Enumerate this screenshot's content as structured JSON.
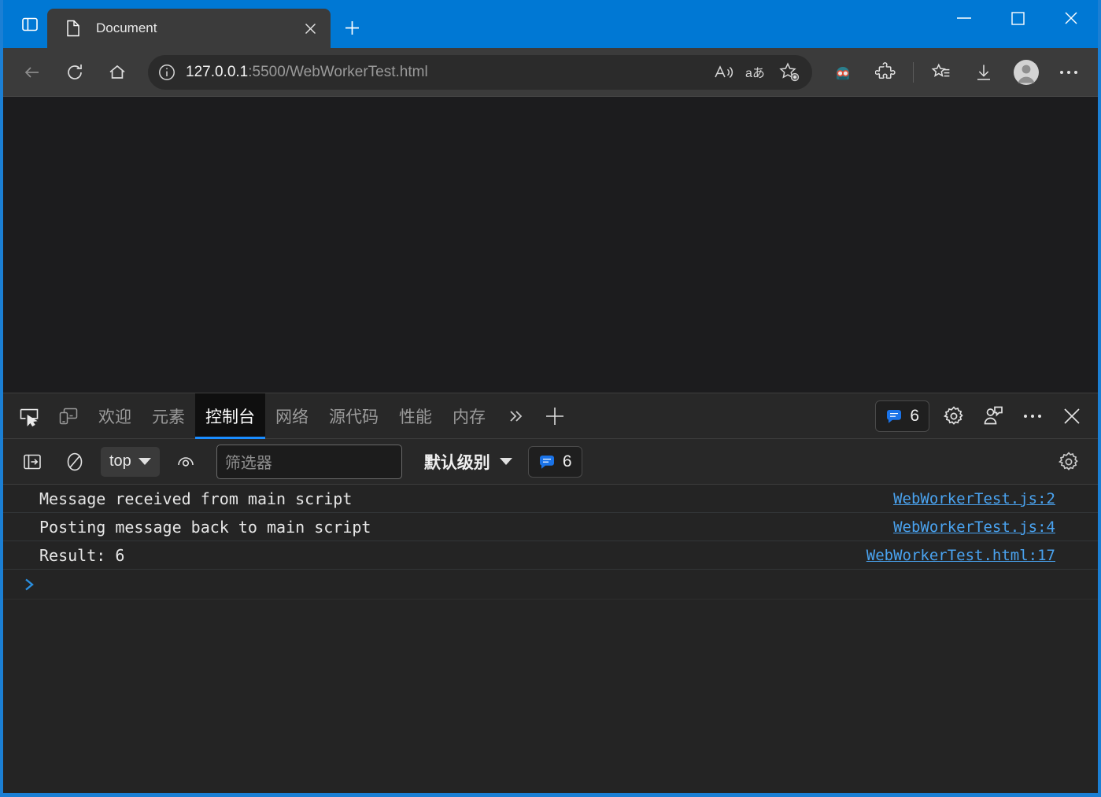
{
  "window": {
    "accent_color": "#0078d4",
    "controls": {
      "minimize": "minimize",
      "maximize": "maximize",
      "close": "close"
    }
  },
  "browser": {
    "tab_actions_label": "tab-actions",
    "tabs": [
      {
        "title": "Document",
        "favicon": "page-icon",
        "close_label": "close-tab"
      }
    ],
    "new_tab_label": "new-tab",
    "toolbar": {
      "back_label": "back",
      "refresh_label": "refresh",
      "home_label": "home",
      "read_aloud_label": "read-aloud",
      "translate_label": "translate",
      "add_favorite_label": "add-favorite",
      "extension_label": "browser-extension",
      "extensions_label": "extensions",
      "collections_label": "collections",
      "downloads_label": "downloads",
      "profile_label": "profile",
      "settings_more_label": "settings-and-more"
    },
    "omnibox": {
      "host": "127.0.0.1",
      "path": ":5500/WebWorkerTest.html",
      "info_icon": "site-information-icon"
    }
  },
  "devtools": {
    "inspect_label": "inspect-element",
    "device_toolbar_label": "device-emulation",
    "tabs": [
      {
        "label": "欢迎",
        "active": false,
        "name": "welcome"
      },
      {
        "label": "元素",
        "active": false,
        "name": "elements"
      },
      {
        "label": "控制台",
        "active": true,
        "name": "console"
      },
      {
        "label": "网络",
        "active": false,
        "name": "network"
      },
      {
        "label": "源代码",
        "active": false,
        "name": "sources"
      },
      {
        "label": "性能",
        "active": false,
        "name": "performance"
      },
      {
        "label": "内存",
        "active": false,
        "name": "memory"
      }
    ],
    "more_tabs_label": "»",
    "add_panel_label": "+",
    "issues_badge_count": "6",
    "settings_label": "settings",
    "feedback_label": "send-feedback",
    "more_options_label": "more-options",
    "close_label": "close-devtools",
    "console_toolbar": {
      "sidebar_toggle_label": "console-sidebar-toggle",
      "clear_label": "clear-console",
      "context_value": "top",
      "live_expression_label": "create-live-expression",
      "filter_placeholder": "筛选器",
      "filter_value": "",
      "level_label": "默认级别",
      "issues_count": "6",
      "settings_label": "console-settings"
    },
    "console_messages": [
      {
        "text": "Message received from main script",
        "number": "",
        "source": "WebWorkerTest.js:2"
      },
      {
        "text": "Posting message back to main script",
        "number": "",
        "source": "WebWorkerTest.js:4"
      },
      {
        "text": "Result: ",
        "number": "6",
        "source": "WebWorkerTest.html:17"
      }
    ],
    "prompt_symbol": "prompt-chevron"
  }
}
